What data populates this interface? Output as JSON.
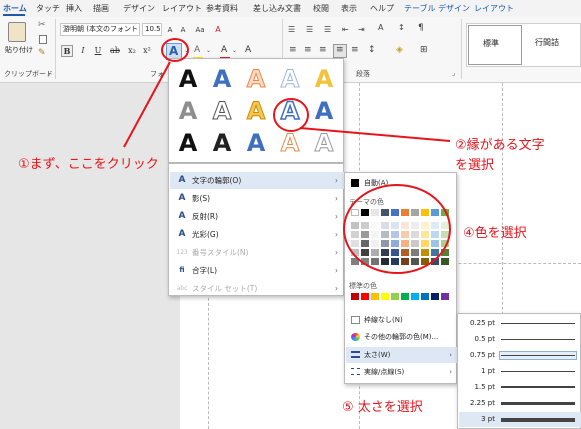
{
  "tabs": [
    {
      "label": "ホーム",
      "selected": true
    },
    {
      "label": "タッチ"
    },
    {
      "label": "挿入"
    },
    {
      "label": "描画"
    },
    {
      "label": "デザイン"
    },
    {
      "label": "レイアウト"
    },
    {
      "label": "参考資料"
    },
    {
      "label": "差し込み文書"
    },
    {
      "label": "校閲"
    },
    {
      "label": "表示"
    },
    {
      "label": "ヘルプ"
    },
    {
      "label": "テーブル デザイン",
      "contextual": true
    },
    {
      "label": "レイアウト",
      "contextual": true
    }
  ],
  "ribbon": {
    "paste_label": "貼り付け",
    "clipboard_label": "クリップボード",
    "font_name": "游明朝 (本文のフォント",
    "font_size": "10.5",
    "font_group_label": "フォ",
    "paragraph_label": "段落",
    "styles": [
      "標準",
      "行間詰"
    ],
    "bold": "B",
    "italic": "I",
    "underline": "U",
    "strike": "ab",
    "subscript": "x₂",
    "text_effects_glyph": "A",
    "highlight_glyph": "A",
    "font_color_glyph": "A",
    "aa_glyph": "Aa",
    "clear_glyph": "A"
  },
  "gallery": {
    "glyph": "A",
    "colors": {
      "black": "#111111",
      "blue": "#3f6fc0",
      "orange": "#f2a66f",
      "gold": "#f2c23a",
      "gray": "#9a9a9a"
    }
  },
  "menu": {
    "items": [
      {
        "icon": "A",
        "label": "文字の輪郭(O)",
        "arrow": "›",
        "highlighted": true
      },
      {
        "icon": "A",
        "label": "影(S)",
        "arrow": "›"
      },
      {
        "icon": "A",
        "label": "反射(R)",
        "arrow": "›"
      },
      {
        "icon": "A",
        "label": "光彩(G)",
        "arrow": "›"
      },
      {
        "icon": "123",
        "label": "番号スタイル(N)",
        "arrow": "›",
        "disabled": true
      },
      {
        "icon": "fi",
        "label": "合字(L)",
        "arrow": "›"
      },
      {
        "icon": "abc",
        "label": "スタイル セット(T)",
        "arrow": "›",
        "disabled": true
      }
    ]
  },
  "color_panel": {
    "auto_label": "自動(A)",
    "theme_label": "テーマの色",
    "standard_label": "標準の色",
    "no_outline_label": "枠線なし(N)",
    "more_colors_label": "その他の輪郭の色(M)...",
    "weight_label": "太さ(W)",
    "dash_label": "実線/点線(S)",
    "arrow": "›",
    "theme_colors": [
      "#ffffff",
      "#000000",
      "#e7e6e6",
      "#44546a",
      "#4472c4",
      "#ed7d31",
      "#a5a5a5",
      "#ffc000",
      "#5b9bd5",
      "#70ad47"
    ],
    "standard_colors": [
      "#c00000",
      "#ff0000",
      "#ffc000",
      "#ffff00",
      "#92d050",
      "#00b050",
      "#00b0f0",
      "#0070c0",
      "#002060",
      "#7030a0"
    ]
  },
  "weight_panel": {
    "items": [
      "0.25 pt",
      "0.5 pt",
      "0.75 pt",
      "1 pt",
      "1.5 pt",
      "2.25 pt",
      "3 pt"
    ],
    "selected_index": 6
  },
  "annotations": {
    "step1": "①まず、ここをクリック",
    "step2_line1": "②縁がある文字",
    "step2_line2": "を選択",
    "step4": "④色を選択",
    "step5": "⑤ 太さを選択",
    "color": "#e8141b"
  }
}
